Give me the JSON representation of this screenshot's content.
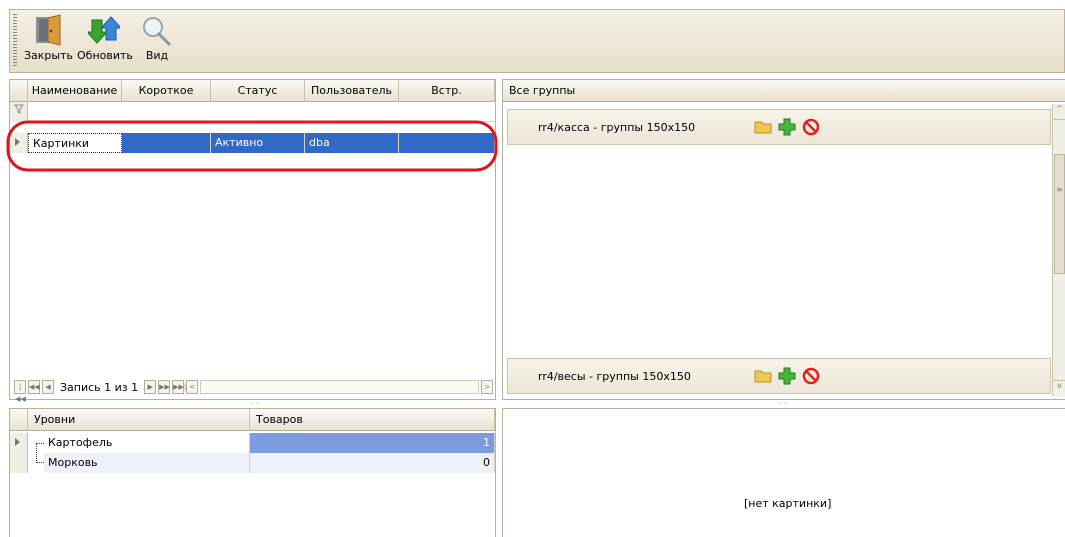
{
  "toolbar": {
    "close_label": "Закрыть",
    "refresh_label": "Обновить",
    "view_label": "Вид"
  },
  "top_grid": {
    "columns": [
      "Наименование",
      "Короткое",
      "Статус",
      "Пользователь",
      "Встр."
    ],
    "rows": [
      {
        "name": "Картинки",
        "short": "",
        "status": "Активно",
        "user": "dba",
        "embedded": ""
      }
    ],
    "navigator": {
      "record_text": "Запись 1 из 1"
    }
  },
  "bottom_grid": {
    "columns": [
      "Уровни",
      "Товаров"
    ],
    "rows": [
      {
        "level": "Картофель",
        "count": "1"
      },
      {
        "level": "Морковь",
        "count": "0"
      }
    ]
  },
  "groups_panel": {
    "title": "Все группы",
    "groups": [
      {
        "title": "rr4/касса - группы 150x150"
      },
      {
        "title": "rr4/весы - группы 150x150"
      }
    ]
  },
  "image_panel": {
    "placeholder": "[нет картинки]"
  },
  "colors": {
    "selection": "#3169c6",
    "highlight_outline": "#e0141e",
    "count_highlight": "#7d9be0"
  }
}
